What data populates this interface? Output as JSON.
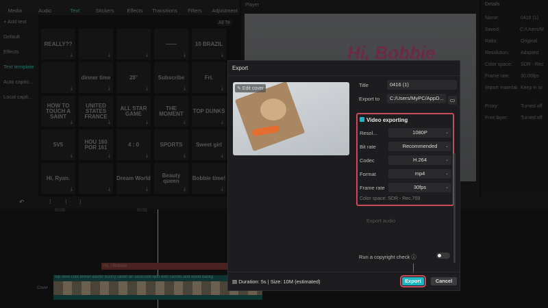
{
  "top_tabs": [
    "Media",
    "Audio",
    "Text",
    "Stickers",
    "Effects",
    "Transitions",
    "Filters",
    "Adjustment"
  ],
  "active_tab": "Text",
  "sidebar": [
    "+ Add text",
    "Default",
    "Effects",
    "Text template",
    "Auto captio...",
    "Local capti..."
  ],
  "active_sidebar": "Text template",
  "all_filter": "All Te",
  "templates": [
    "REALLY??",
    "",
    "",
    "——",
    "10 BRAZIL",
    "",
    "dinner time",
    "28°",
    "Subscribe",
    "Fri.",
    "HOW TO TOUCH A SAINT",
    "UNITED STATES FRANCE",
    "ALL STAR GAME",
    "THE MOMENT",
    "TOP DUNKS",
    "5V5",
    "HOU 160 POR 161",
    "4 : 0",
    "SPORTS",
    "Sweet girl",
    "Hi, Ryan.",
    "",
    "Dream World",
    "Beauty queen",
    "Bobbie time!"
  ],
  "player": {
    "title": "Player",
    "overlay_text": "Hi, Bobbie"
  },
  "details": {
    "title": "Details",
    "rows": [
      [
        "Name:",
        "0416 (1)"
      ],
      [
        "Saved:",
        "C:/Users/M"
      ],
      [
        "Ratio:",
        "Original"
      ],
      [
        "Resolution:",
        "Adapted"
      ],
      [
        "Color space:",
        "SDR - Rec"
      ],
      [
        "Frame rate:",
        "30.00fps"
      ],
      [
        "Import material:",
        "Keep in or"
      ],
      [
        "Proxy:",
        "Turned off"
      ],
      [
        "Free layer:",
        "Turned off"
      ]
    ]
  },
  "timeline": {
    "ruler": [
      "00:00",
      "00:02"
    ],
    "text_clip": "HI, / Robbie",
    "video_clip": "top view cute brown easter bunny rabbit on sackcloth with with carrots and wood backg",
    "cover_label": "Cover"
  },
  "dialog": {
    "title": "Export",
    "edit_cover": "Edit cover",
    "title_label": "Title",
    "title_value": "0416 (1)",
    "export_to_label": "Export to",
    "export_to_value": "C:/Users/MyPC/AppD...",
    "video_exporting": "Video exporting",
    "video_checked": true,
    "settings": [
      {
        "label": "Resol...",
        "value": "1080P"
      },
      {
        "label": "Bit rate",
        "value": "Recommended"
      },
      {
        "label": "Codec",
        "value": "H.264"
      },
      {
        "label": "Format",
        "value": "mp4"
      },
      {
        "label": "Frame rate",
        "value": "30fps"
      }
    ],
    "color_space": "Color space: SDR - Rec.709",
    "export_audio": "Export audio",
    "copyright": "Run a copyright check",
    "copyright_on": false,
    "footer": "Duration: 5s | Size: 10M (estimated)",
    "export_btn": "Export",
    "cancel_btn": "Cancel"
  },
  "colors": {
    "accent": "#1fb5c7",
    "highlight": "#c84b5a"
  }
}
